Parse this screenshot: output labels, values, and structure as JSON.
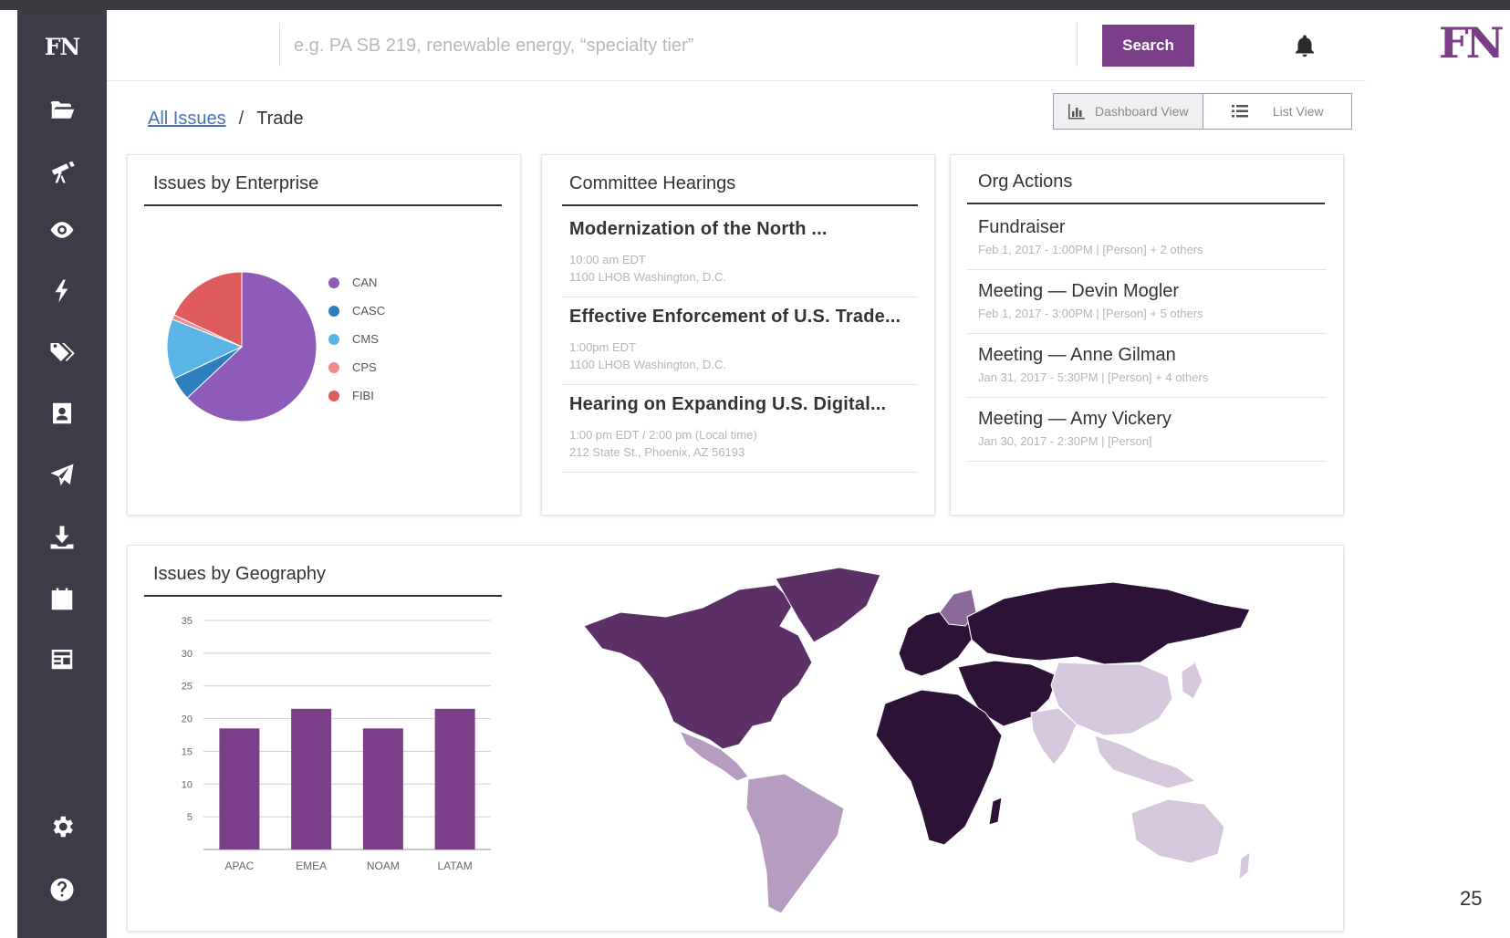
{
  "sidebar": {
    "logo": "FN",
    "icons": [
      "folder-open-icon",
      "telescope-icon",
      "eye-icon",
      "bolt-icon",
      "tags-icon",
      "contact-card-icon",
      "paper-plane-icon",
      "download-icon",
      "calendar-icon",
      "newspaper-icon",
      "gear-icon",
      "help-icon"
    ]
  },
  "search": {
    "placeholder": "e.g. PA SB 219, renewable energy, “specialty tier”",
    "button_label": "Search"
  },
  "brand": "FN",
  "breadcrumb": {
    "link": "All Issues",
    "separator": "/",
    "current": "Trade"
  },
  "view_toggle": {
    "dashboard_label": "Dashboard View",
    "list_label": "List View",
    "active": "dashboard"
  },
  "enterprise": {
    "title": "Issues by Enterprise",
    "legend": [
      "CAN",
      "CASC",
      "CMS",
      "CPS",
      "FIBI"
    ]
  },
  "hearings": {
    "title": "Committee Hearings",
    "items": [
      {
        "title": "Modernization of the North ...",
        "time": "10:00 am EDT",
        "location": "1100 LHOB Washington, D.C."
      },
      {
        "title": "Effective Enforcement of U.S. Trade...",
        "time": "1:00pm EDT",
        "location": "1100 LHOB Washington, D.C."
      },
      {
        "title": "Hearing on Expanding U.S. Digital...",
        "time": "1:00 pm EDT / 2:00 pm (Local time)",
        "location": "212 State St., Phoenix, AZ 56193"
      }
    ]
  },
  "org_actions": {
    "title": "Org Actions",
    "items": [
      {
        "title": "Fundraiser",
        "meta": "Feb 1, 2017 - 1:00PM | [Person] + 2 others"
      },
      {
        "title": "Meeting — Devin Mogler",
        "meta": "Feb 1, 2017 - 3:00PM | [Person] + 5 others"
      },
      {
        "title": "Meeting — Anne Gilman",
        "meta": "Jan 31, 2017 - 5:30PM | [Person] + 4 others"
      },
      {
        "title": "Meeting — Amy Vickery",
        "meta": "Jan 30, 2017 - 2:30PM | [Person]"
      }
    ]
  },
  "geography": {
    "title": "Issues by Geography"
  },
  "colors": {
    "accent": "#7b3f8a",
    "sidebar": "#3c3b48",
    "pie": [
      "#8e5bb8",
      "#2f7ebc",
      "#5ab4e6",
      "#f08a8a",
      "#e05c5c"
    ],
    "map": [
      "#2c1237",
      "#5c2f66",
      "#8b6a9a",
      "#b69cc0",
      "#d6c8dc"
    ]
  },
  "chart_data": [
    {
      "type": "pie",
      "title": "Issues by Enterprise",
      "categories": [
        "CAN",
        "CASC",
        "CMS",
        "CPS",
        "FIBI"
      ],
      "values": [
        63,
        5,
        13,
        1,
        18
      ]
    },
    {
      "type": "bar",
      "title": "Issues by Geography",
      "categories": [
        "APAC",
        "EMEA",
        "NOAM",
        "LATAM"
      ],
      "values": [
        18.5,
        21.5,
        18.5,
        21.5
      ],
      "ylim": [
        0,
        35
      ],
      "yticks": [
        5,
        10,
        15,
        20,
        25,
        30,
        35
      ],
      "grid": true
    }
  ],
  "page_number": "25"
}
